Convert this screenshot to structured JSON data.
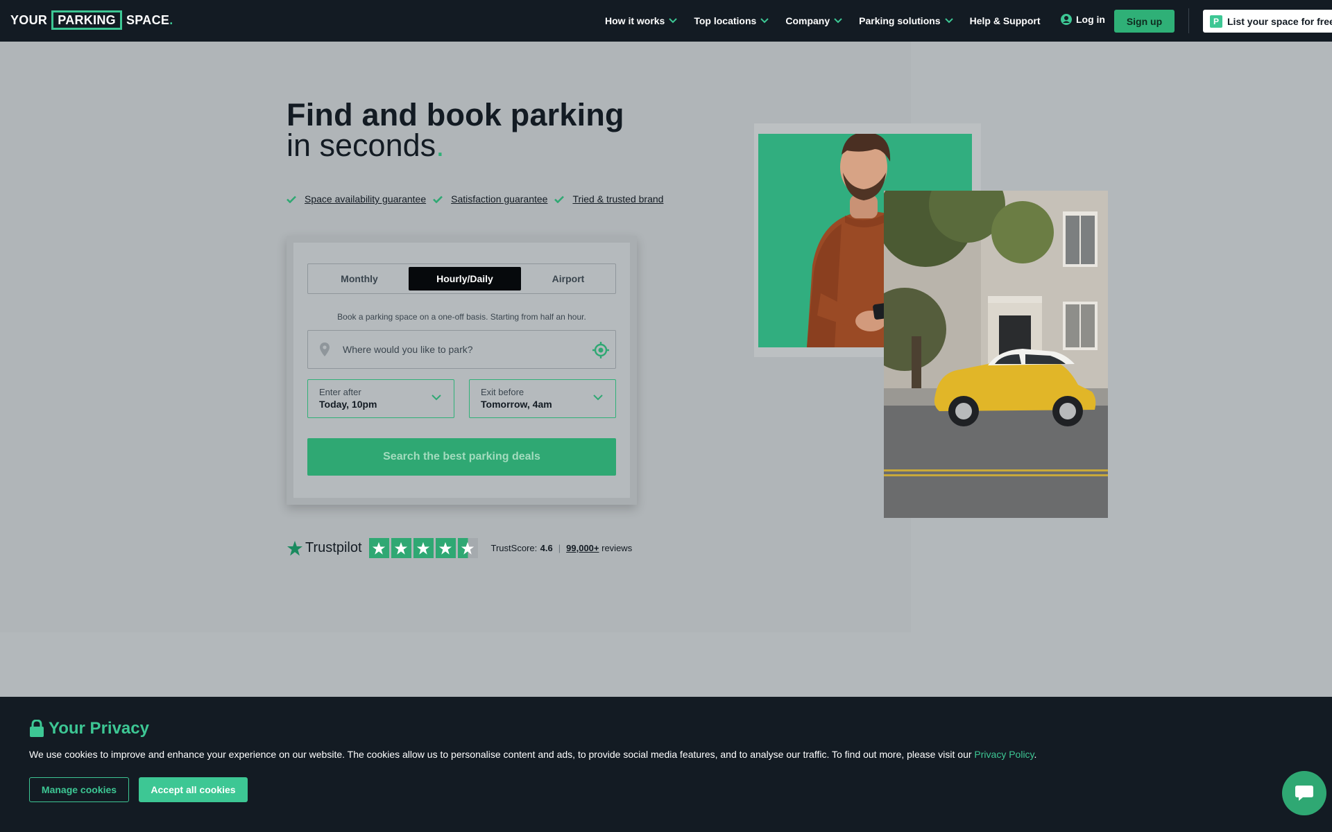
{
  "brand": {
    "logo_part1": "YOUR",
    "logo_part2": "PARKING",
    "logo_part3": "SPACE",
    "logo_dot": ".",
    "accent_color": "#3dc794"
  },
  "nav": {
    "items": [
      {
        "label": "How it works",
        "has_dropdown": true
      },
      {
        "label": "Top locations",
        "has_dropdown": true
      },
      {
        "label": "Company",
        "has_dropdown": true
      },
      {
        "label": "Parking solutions",
        "has_dropdown": true
      },
      {
        "label": "Help & Support",
        "has_dropdown": false
      }
    ],
    "login_label": "Log in",
    "signup_label": "Sign up",
    "list_space_label": "List your space for free",
    "list_space_icon_letter": "P"
  },
  "hero": {
    "title_line1": "Find and book parking",
    "title_line2": "in seconds",
    "title_dot": ".",
    "guarantees": [
      "Space availability guarantee",
      "Satisfaction guarantee",
      "Tried & trusted brand"
    ]
  },
  "booking": {
    "tabs": [
      {
        "label": "Monthly",
        "selected": false
      },
      {
        "label": "Hourly/Daily",
        "selected": true
      },
      {
        "label": "Airport",
        "selected": false
      }
    ],
    "description": "Book a parking space on a one-off basis. Starting from half an hour.",
    "location_placeholder": "Where would you like to park?",
    "location_value": "",
    "enter_label": "Enter after",
    "enter_value": "Today, 10pm",
    "exit_label": "Exit before",
    "exit_value": "Tomorrow, 4am",
    "search_label": "Search the best parking deals"
  },
  "trustpilot": {
    "brand": "Trustpilot",
    "score_label": "TrustScore:",
    "score": "4.6",
    "rating_stars": 4.5,
    "separator": "|",
    "reviews_count": "99,000+",
    "reviews_label": "reviews"
  },
  "cookie": {
    "title": "Your Privacy",
    "text": "We use cookies to improve and enhance your experience on our website. The cookies allow us to personalise content and ads, to provide social media features, and to analyse our traffic. To find out more, please visit our",
    "policy_link": "Privacy Policy",
    "text_end": ".",
    "manage_label": "Manage cookies",
    "accept_label": "Accept all cookies"
  }
}
